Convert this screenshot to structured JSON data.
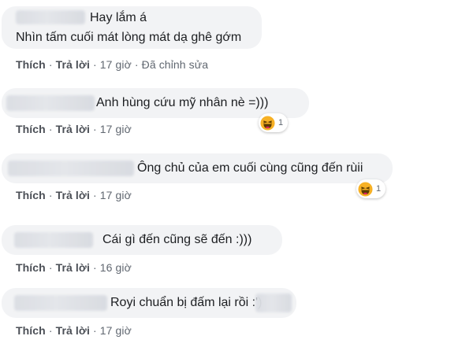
{
  "comments": [
    {
      "lines": [
        "Hay lắm á",
        "Nhìn tấm cuối mát lòng mát dạ ghê gớm"
      ],
      "actions": {
        "like": "Thích",
        "reply": "Trả lời",
        "time": "17 giờ",
        "edited": "Đã chỉnh sửa"
      },
      "reaction": null
    },
    {
      "lines": [
        "Anh hùng cứu mỹ nhân nè =)))"
      ],
      "actions": {
        "like": "Thích",
        "reply": "Trả lời",
        "time": "17 giờ"
      },
      "reaction": {
        "icon": "haha-icon",
        "count": "1"
      }
    },
    {
      "lines": [
        "Ông chủ của em cuối cùng cũng đến rùii"
      ],
      "actions": {
        "like": "Thích",
        "reply": "Trả lời",
        "time": "17 giờ"
      },
      "reaction": {
        "icon": "haha-icon",
        "count": "1"
      }
    },
    {
      "lines": [
        "Cái gì đến cũng sẽ đến :)))"
      ],
      "actions": {
        "like": "Thích",
        "reply": "Trả lời",
        "time": "16 giờ"
      },
      "reaction": null
    },
    {
      "lines": [
        "Royi chuẩn bị đấm lại rồi :')"
      ],
      "actions": {
        "like": "Thích",
        "reply": "Trả lời",
        "time": "17 giờ"
      },
      "reaction": null
    }
  ],
  "separator": "·",
  "colors": {
    "bubble": "#f2f3f5",
    "text": "#1c1e21",
    "meta": "#606770",
    "haha_face": "#f7b125"
  }
}
